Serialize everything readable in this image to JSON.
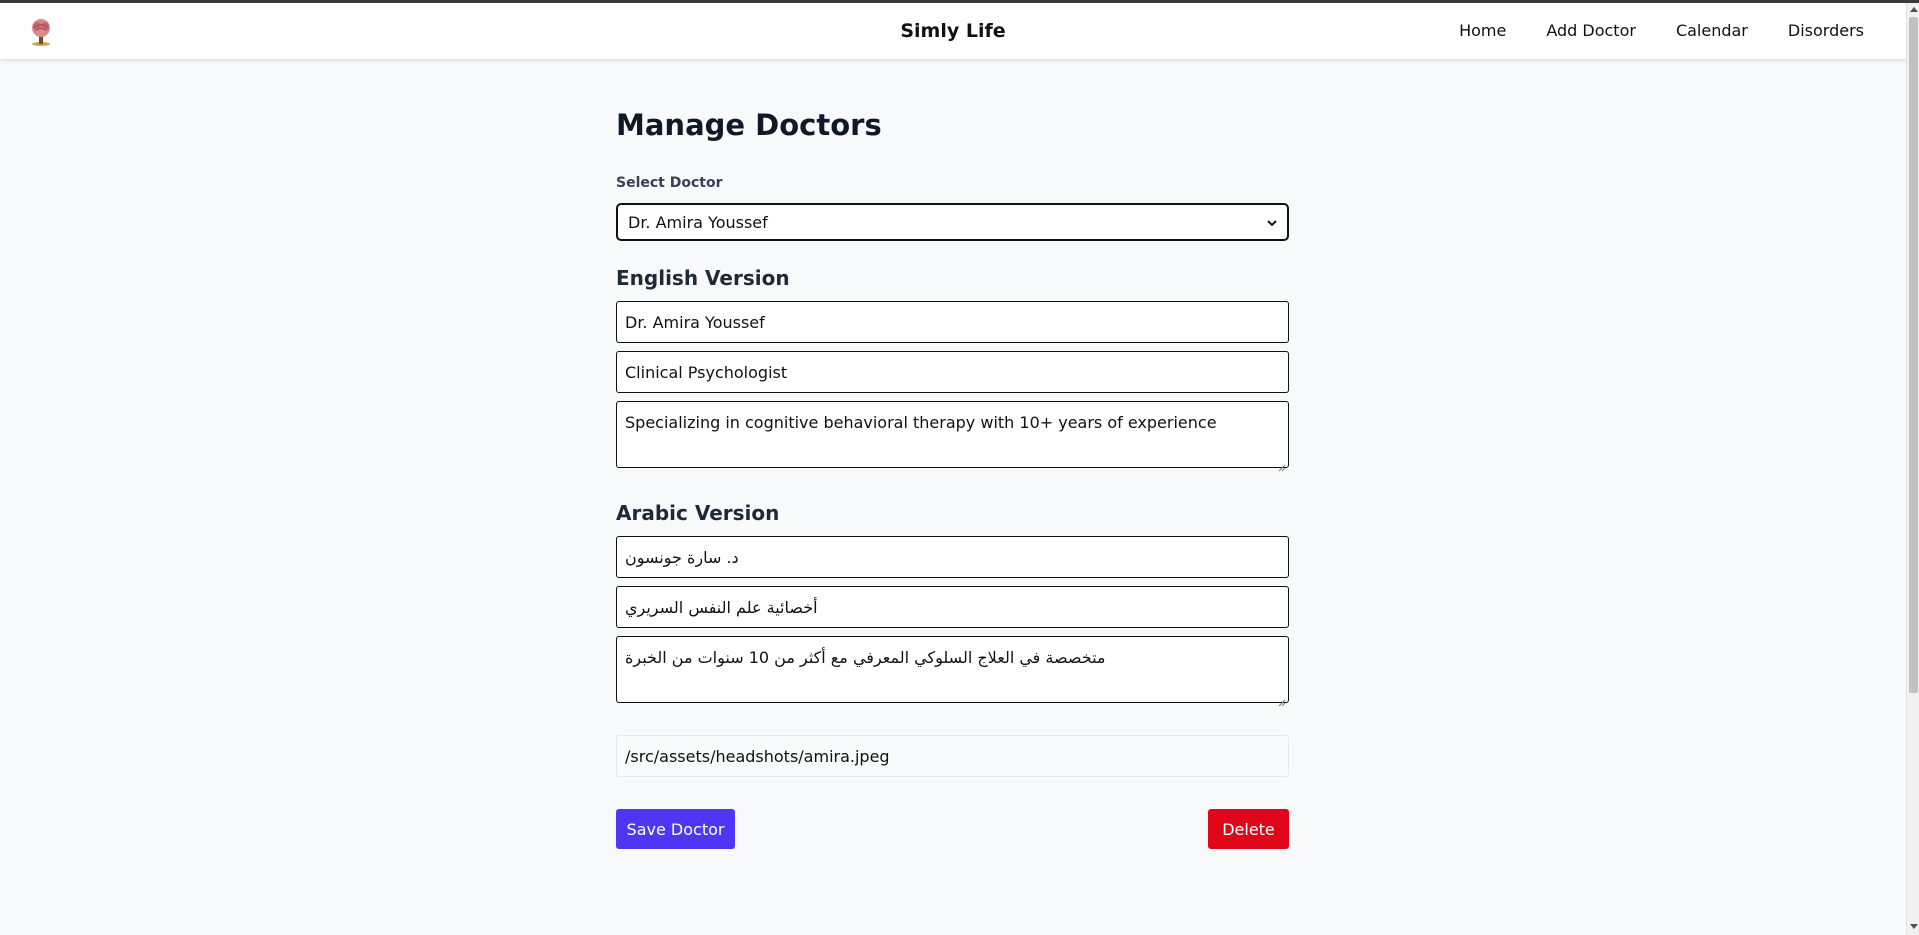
{
  "navbar": {
    "logo_icon": "brain-tree-logo-icon",
    "brand": "Simly Life",
    "links": [
      "Home",
      "Add Doctor",
      "Calendar",
      "Disorders"
    ]
  },
  "page": {
    "title": "Manage Doctors",
    "select_label": "Select Doctor",
    "selected_doctor": "Dr. Amira Youssef"
  },
  "english": {
    "heading": "English Version",
    "name": "Dr. Amira Youssef",
    "title": "Clinical Psychologist",
    "bio": "Specializing in cognitive behavioral therapy with 10+ years of experience"
  },
  "arabic": {
    "heading": "Arabic Version",
    "name": "د. سارة جونسون",
    "title": "أخصائية علم النفس السريري",
    "bio": "متخصصة في العلاج السلوكي المعرفي مع أكثر من 10 سنوات من الخبرة"
  },
  "image_path": "/src/assets/headshots/amira.jpeg",
  "actions": {
    "save_label": "Save Doctor",
    "delete_label": "Delete"
  },
  "colors": {
    "save_button": "#4f36f5",
    "delete_button": "#e0061a",
    "page_background": "#f8f9fb"
  }
}
